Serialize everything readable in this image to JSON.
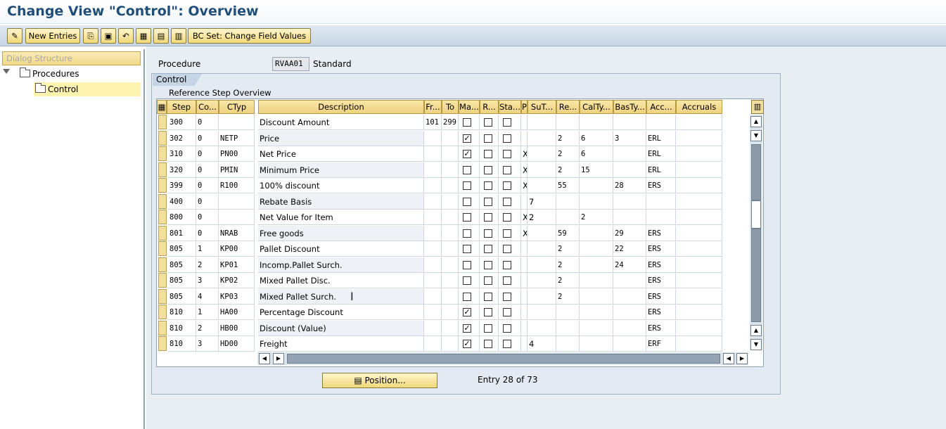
{
  "window": {
    "title": "Change View \"Control\": Overview"
  },
  "toolbar": {
    "new_entries_label": "New Entries",
    "bc_set_label": "BC Set: Change Field Values",
    "icons": [
      "change-display-icon",
      "copy-icon",
      "save-icon",
      "undo-icon",
      "select-all-icon",
      "deselect-icon",
      "select-block-icon"
    ]
  },
  "sidebar": {
    "header": "Dialog Structure",
    "items": [
      {
        "label": "Procedures",
        "icon": "folder-icon"
      },
      {
        "label": "Control",
        "icon": "folder-open-icon"
      }
    ]
  },
  "main": {
    "procedure_label": "Procedure",
    "procedure_value": "RVAA01",
    "procedure_desc": "Standard",
    "tab_label": "Control",
    "table_caption": "Reference Step Overview",
    "position_button": "Position...",
    "entry_info": "Entry 28 of 73"
  },
  "table": {
    "headers": [
      "Step",
      "Co...",
      "CTyp",
      "Description",
      "Fr...",
      "To",
      "Ma...",
      "R...",
      "Sta...",
      "P",
      "SuT...",
      "Re...",
      "CalTy...",
      "BasTy...",
      "Acc...",
      "Accruals"
    ],
    "rows": [
      {
        "step": "300",
        "co": "0",
        "ctyp": "",
        "desc": "Discount Amount",
        "fr": "101",
        "to": "299",
        "ma": false,
        "r": false,
        "sta": false,
        "p": "",
        "sut": "",
        "re": "",
        "calty": "",
        "basty": "",
        "acc": "",
        "accr": ""
      },
      {
        "step": "302",
        "co": "0",
        "ctyp": "NETP",
        "desc": "Price",
        "fr": "",
        "to": "",
        "ma": true,
        "r": false,
        "sta": false,
        "p": "",
        "sut": "",
        "re": "2",
        "calty": "6",
        "basty": "3",
        "acc": "ERL",
        "accr": ""
      },
      {
        "step": "310",
        "co": "0",
        "ctyp": "PN00",
        "desc": "Net Price",
        "fr": "",
        "to": "",
        "ma": true,
        "r": false,
        "sta": false,
        "p": "X",
        "sut": "",
        "re": "2",
        "calty": "6",
        "basty": "",
        "acc": "ERL",
        "accr": ""
      },
      {
        "step": "320",
        "co": "0",
        "ctyp": "PMIN",
        "desc": "Minimum Price",
        "fr": "",
        "to": "",
        "ma": false,
        "r": false,
        "sta": false,
        "p": "X",
        "sut": "",
        "re": "2",
        "calty": "15",
        "basty": "",
        "acc": "ERL",
        "accr": ""
      },
      {
        "step": "399",
        "co": "0",
        "ctyp": "R100",
        "desc": "100% discount",
        "fr": "",
        "to": "",
        "ma": false,
        "r": false,
        "sta": false,
        "p": "X",
        "sut": "",
        "re": "55",
        "calty": "",
        "basty": "28",
        "acc": "ERS",
        "accr": ""
      },
      {
        "step": "400",
        "co": "0",
        "ctyp": "",
        "desc": "Rebate Basis",
        "fr": "",
        "to": "",
        "ma": false,
        "r": false,
        "sta": false,
        "p": "",
        "sut": "7",
        "re": "",
        "calty": "",
        "basty": "",
        "acc": "",
        "accr": ""
      },
      {
        "step": "800",
        "co": "0",
        "ctyp": "",
        "desc": "Net Value for Item",
        "fr": "",
        "to": "",
        "ma": false,
        "r": false,
        "sta": false,
        "p": "X",
        "sut": "2",
        "re": "",
        "calty": "2",
        "basty": "",
        "acc": "",
        "accr": ""
      },
      {
        "step": "801",
        "co": "0",
        "ctyp": "NRAB",
        "desc": "Free goods",
        "fr": "",
        "to": "",
        "ma": false,
        "r": false,
        "sta": false,
        "p": "X",
        "sut": "",
        "re": "59",
        "calty": "",
        "basty": "29",
        "acc": "ERS",
        "accr": ""
      },
      {
        "step": "805",
        "co": "1",
        "ctyp": "KP00",
        "desc": "Pallet Discount",
        "fr": "",
        "to": "",
        "ma": false,
        "r": false,
        "sta": false,
        "p": "",
        "sut": "",
        "re": "2",
        "calty": "",
        "basty": "22",
        "acc": "ERS",
        "accr": ""
      },
      {
        "step": "805",
        "co": "2",
        "ctyp": "KP01",
        "desc": "Incomp.Pallet Surch.",
        "fr": "",
        "to": "",
        "ma": false,
        "r": false,
        "sta": false,
        "p": "",
        "sut": "",
        "re": "2",
        "calty": "",
        "basty": "24",
        "acc": "ERS",
        "accr": ""
      },
      {
        "step": "805",
        "co": "3",
        "ctyp": "KP02",
        "desc": "Mixed Pallet Disc.",
        "fr": "",
        "to": "",
        "ma": false,
        "r": false,
        "sta": false,
        "p": "",
        "sut": "",
        "re": "2",
        "calty": "",
        "basty": "",
        "acc": "ERS",
        "accr": ""
      },
      {
        "step": "805",
        "co": "4",
        "ctyp": "KP03",
        "desc": "Mixed Pallet Surch.",
        "fr": "",
        "to": "",
        "ma": false,
        "r": false,
        "sta": false,
        "p": "",
        "sut": "",
        "re": "2",
        "calty": "",
        "basty": "",
        "acc": "ERS",
        "accr": ""
      },
      {
        "step": "810",
        "co": "1",
        "ctyp": "HA00",
        "desc": "Percentage Discount",
        "fr": "",
        "to": "",
        "ma": true,
        "r": false,
        "sta": false,
        "p": "",
        "sut": "",
        "re": "",
        "calty": "",
        "basty": "",
        "acc": "ERS",
        "accr": ""
      },
      {
        "step": "810",
        "co": "2",
        "ctyp": "HB00",
        "desc": "Discount (Value)",
        "fr": "",
        "to": "",
        "ma": true,
        "r": false,
        "sta": false,
        "p": "",
        "sut": "",
        "re": "",
        "calty": "",
        "basty": "",
        "acc": "ERS",
        "accr": ""
      },
      {
        "step": "810",
        "co": "3",
        "ctyp": "HD00",
        "desc": "Freight",
        "fr": "",
        "to": "",
        "ma": true,
        "r": false,
        "sta": false,
        "p": "",
        "sut": "4",
        "re": "",
        "calty": "",
        "basty": "",
        "acc": "ERF",
        "accr": ""
      }
    ]
  }
}
